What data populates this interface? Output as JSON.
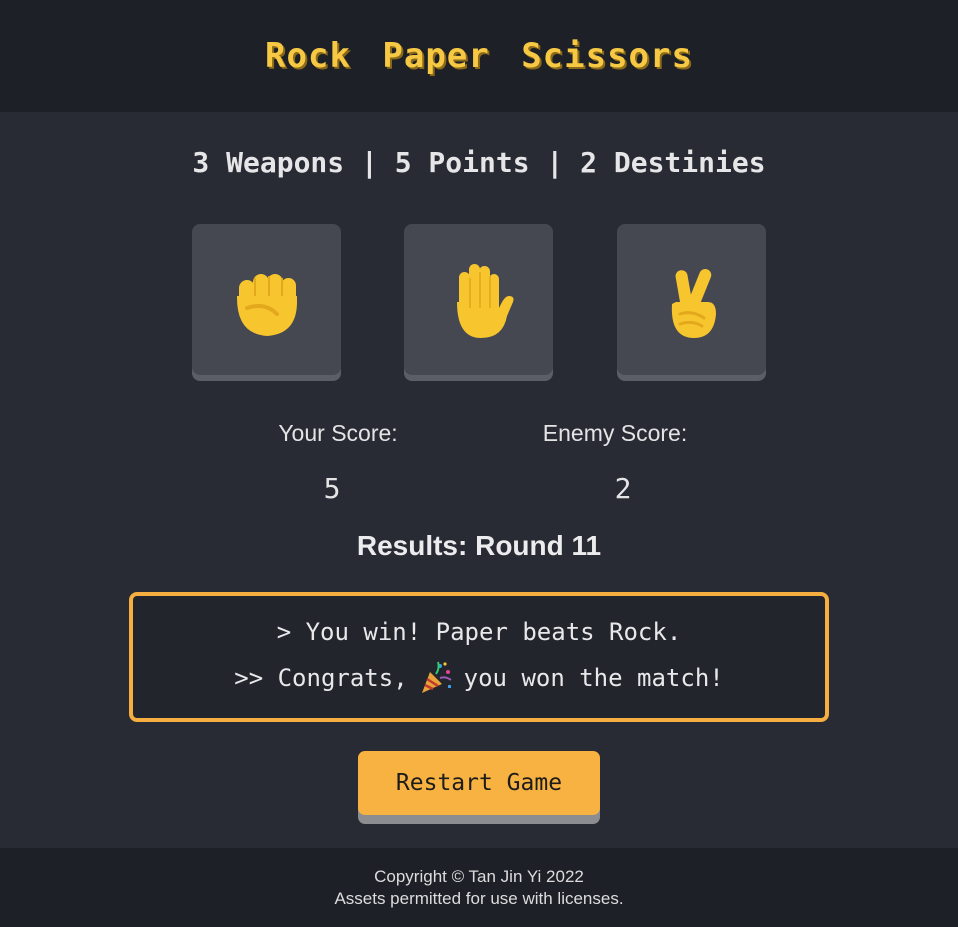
{
  "header": {
    "title": "Rock Paper Scissors"
  },
  "tagline": "3 Weapons | 5 Points | 2 Destinies",
  "weapons": [
    {
      "icon": "rock-fist-icon"
    },
    {
      "icon": "paper-hand-icon"
    },
    {
      "icon": "scissors-victory-hand-icon"
    }
  ],
  "scores": {
    "player_label": "Your Score:",
    "player_value": "5",
    "enemy_label": "Enemy Score:",
    "enemy_value": "2"
  },
  "results_heading": "Results: Round 11",
  "messages": {
    "line1": "> You win! Paper beats Rock.",
    "line2_prefix": ">> Congrats,",
    "line2_icon": "party-popper-icon",
    "line2_suffix": "you won the match!"
  },
  "restart_label": "Restart Game",
  "footer": {
    "copyright": "Copyright © Tan Jin Yi 2022",
    "license": "Assets permitted for use with licenses."
  },
  "colors": {
    "accent": "#f7b241",
    "title": "#f7c843",
    "background": "#282b33",
    "header_bg": "#1e2027",
    "card_bg": "#464851"
  }
}
